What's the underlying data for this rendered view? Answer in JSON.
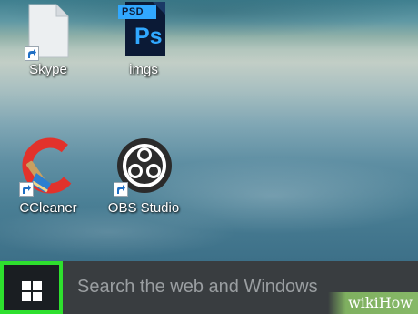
{
  "desktop": {
    "icons": [
      {
        "label": "Skype",
        "icon": "blank-file-shortcut-icon"
      },
      {
        "label": "imgs",
        "icon": "photoshop-psd-file-icon",
        "badge": "PSD",
        "mark": "Ps"
      },
      {
        "label": "CCleaner",
        "icon": "ccleaner-icon"
      },
      {
        "label": "OBS Studio",
        "icon": "obs-studio-icon"
      }
    ]
  },
  "taskbar": {
    "start_icon": "windows-logo-icon",
    "search_placeholder": "Search the web and Windows"
  },
  "watermark": "wikiHow",
  "colors": {
    "start_highlight": "#2ee02e",
    "taskbar": "#1a1e22",
    "search_box": "#393d40",
    "photoshop_blue": "#31a8ff",
    "ccleaner_red": "#e2322b"
  }
}
